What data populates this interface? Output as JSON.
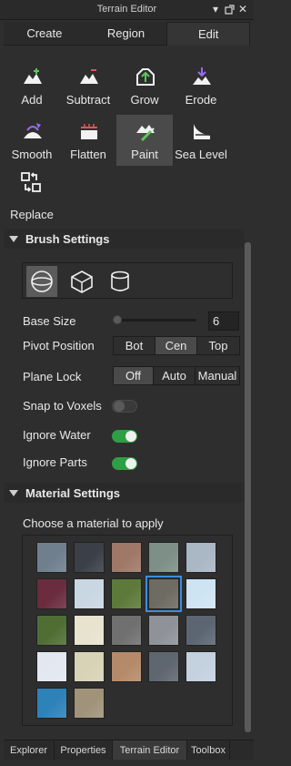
{
  "window": {
    "title": "Terrain Editor"
  },
  "tabs": [
    {
      "label": "Create"
    },
    {
      "label": "Region"
    },
    {
      "label": "Edit"
    }
  ],
  "tools": [
    {
      "label": "Add",
      "icon": "add-terrain-icon"
    },
    {
      "label": "Subtract",
      "icon": "subtract-terrain-icon"
    },
    {
      "label": "Grow",
      "icon": "grow-terrain-icon"
    },
    {
      "label": "Erode",
      "icon": "erode-terrain-icon"
    },
    {
      "label": "Smooth",
      "icon": "smooth-terrain-icon"
    },
    {
      "label": "Flatten",
      "icon": "flatten-terrain-icon"
    },
    {
      "label": "Paint",
      "icon": "paint-terrain-icon"
    },
    {
      "label": "Sea Level",
      "icon": "sea-level-icon"
    },
    {
      "label": "Replace",
      "icon": "replace-terrain-icon"
    }
  ],
  "brush": {
    "header": "Brush Settings",
    "shapes": [
      "sphere",
      "cube",
      "cylinder"
    ],
    "base_size_label": "Base Size",
    "base_size_value": "6",
    "pivot_label": "Pivot Position",
    "pivot_options": [
      "Bot",
      "Cen",
      "Top"
    ],
    "plane_lock_label": "Plane Lock",
    "plane_lock_options": [
      "Off",
      "Auto",
      "Manual"
    ],
    "snap_label": "Snap to Voxels",
    "snap_on": false,
    "ignore_water_label": "Ignore Water",
    "ignore_water_on": true,
    "ignore_parts_label": "Ignore Parts",
    "ignore_parts_on": true
  },
  "material": {
    "header": "Material Settings",
    "prompt": "Choose a material to apply",
    "swatches": [
      "#6f7f8e",
      "#3b3f47",
      "#a07868",
      "#7d8f86",
      "#aab7c4",
      "#6a2c3e",
      "#c9d7e3",
      "#5e7a3a",
      "#6e6b62",
      "#cfe4f2",
      "#4f6e34",
      "#e8e3cf",
      "#707070",
      "#8f9399",
      "#5c6673",
      "#e3e7f0",
      "#d8d3b6",
      "#b58a6a",
      "#5e6670",
      "#c4d1df",
      "#2e82ba",
      "#a0937a"
    ]
  },
  "bottom_tabs": [
    "Explorer",
    "Properties",
    "Terrain Editor",
    "Toolbox"
  ],
  "colors": {
    "accent": "#3a8edb",
    "toggle_on": "#2f9e44",
    "icon_green": "#5ac85a",
    "icon_red": "#e05555",
    "icon_purple": "#9a6cf0"
  }
}
